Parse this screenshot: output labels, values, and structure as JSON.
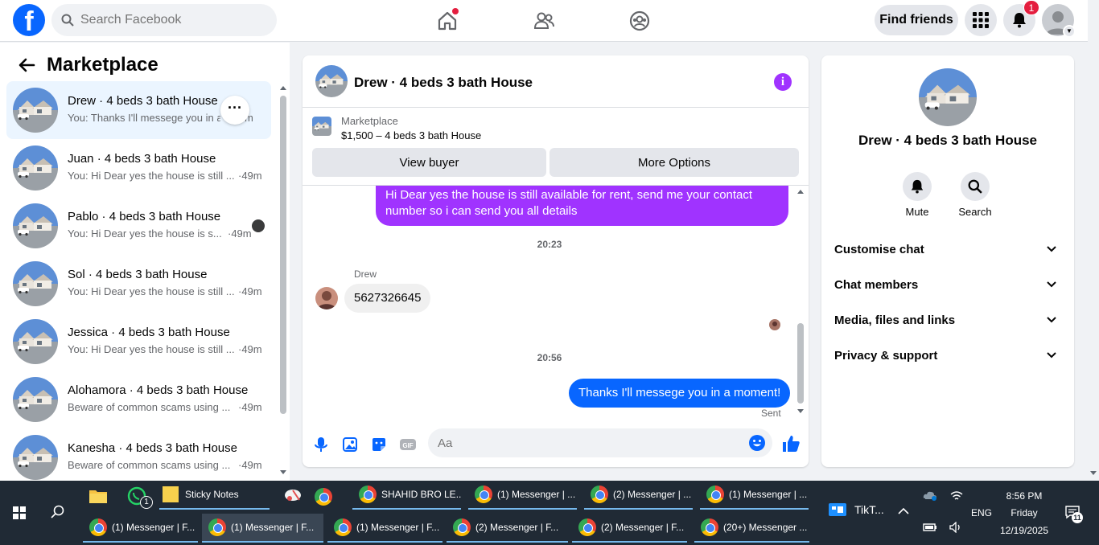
{
  "topbar": {
    "search_placeholder": "Search Facebook",
    "find_friends_label": "Find friends",
    "notification_count": "1",
    "brand_color": "#0866ff",
    "logo_letter": "f"
  },
  "sidebar": {
    "title": "Marketplace",
    "conversations": [
      {
        "name": "Drew · 4 beds 3 bath House",
        "snippet": "You: Thanks I'll messege you in a moment!",
        "time": "m",
        "active": true
      },
      {
        "name": "Juan · 4 beds 3 bath House",
        "snippet": "You: Hi Dear yes the house is still ...",
        "time": "·49m"
      },
      {
        "name": "Pablo · 4 beds 3 bath House",
        "snippet": "You: Hi Dear yes the house is s...",
        "time": "·49m"
      },
      {
        "name": "Sol · 4 beds 3 bath House",
        "snippet": "You: Hi Dear yes the house is still ...",
        "time": "·49m"
      },
      {
        "name": "Jessica · 4 beds 3 bath House",
        "snippet": "You: Hi Dear yes the house is still ...",
        "time": "·49m"
      },
      {
        "name": "Alohamora · 4 beds 3 bath House",
        "snippet": "Beware of common scams using ...",
        "time": "·49m"
      },
      {
        "name": "Kanesha · 4 beds 3 bath House",
        "snippet": "Beware of common scams using ...",
        "time": "·49m"
      }
    ]
  },
  "chat": {
    "title": "Drew · 4 beds 3 bath House",
    "listing_label": "Marketplace",
    "listing_price": "$1,500 – 4 beds 3 bath House",
    "view_buyer_label": "View buyer",
    "more_options_label": "More Options",
    "messages": {
      "outgoing_1": "Hi Dear yes the house is still available for rent, send me your contact number so i can send you all details",
      "time_1": "20:23",
      "sender_name": "Drew",
      "incoming_1": "5627326645",
      "time_2": "20:56",
      "outgoing_2": "Thanks I'll messege you in a moment!",
      "status": "Sent"
    },
    "input_placeholder": "Aa",
    "accent_color": "#a033ff",
    "send_color": "#0866ff"
  },
  "info_panel": {
    "name": "Drew · 4 beds 3 bath House",
    "mute_label": "Mute",
    "search_label": "Search",
    "sections": [
      "Customise chat",
      "Chat members",
      "Media, files and links",
      "Privacy & support"
    ]
  },
  "taskbar": {
    "row1": [
      {
        "label": "Sticky Notes",
        "type": "app"
      },
      {
        "label": "SHAHID BRO LE...",
        "type": "chrome"
      },
      {
        "label": "(1) Messenger | ...",
        "type": "chrome"
      },
      {
        "label": "(2) Messenger | ...",
        "type": "chrome"
      },
      {
        "label": "(1) Messenger | ...",
        "type": "chrome"
      }
    ],
    "row2": [
      {
        "label": "(1) Messenger | F...",
        "type": "chrome"
      },
      {
        "label": "(1) Messenger | F...",
        "type": "chrome"
      },
      {
        "label": "(1) Messenger | F...",
        "type": "chrome"
      },
      {
        "label": "(2) Messenger | F...",
        "type": "chrome"
      },
      {
        "label": "(2) Messenger | F...",
        "type": "chrome"
      },
      {
        "label": "(20+) Messenger ...",
        "type": "chrome"
      }
    ],
    "whatsapp_badge": "1",
    "tiktok_label": "TikT...",
    "lang": "ENG",
    "time": "8:56 PM",
    "day": "Friday",
    "date": "12/19/2025",
    "notif_count": "11"
  }
}
